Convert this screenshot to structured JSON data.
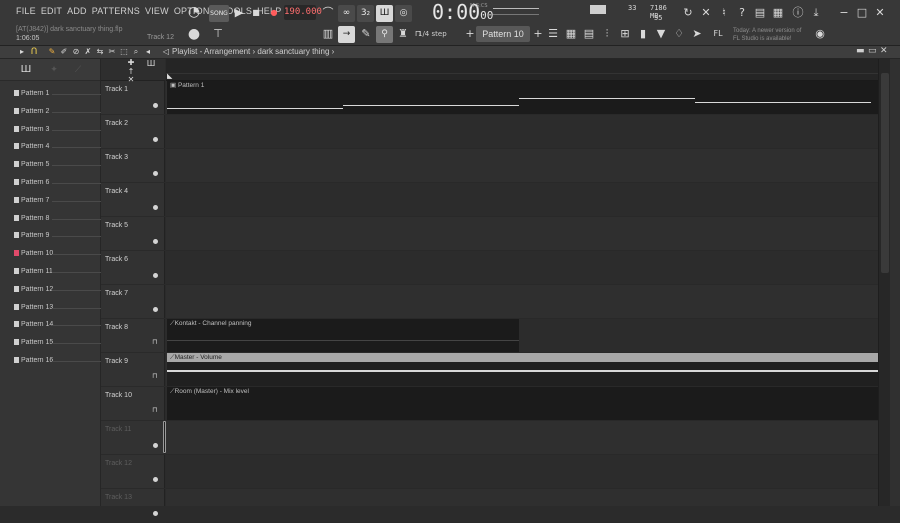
{
  "menu": [
    "FILE",
    "EDIT",
    "ADD",
    "PATTERNS",
    "VIEW",
    "OPTIONS",
    "TOOLS",
    "HELP"
  ],
  "song": {
    "filename": "[AT(J842)] dark sanctuary thing.flp",
    "position": "1:06:05",
    "hint_track": "Track 12"
  },
  "transport": {
    "tempo": "190.000",
    "time_main": "0:00",
    "time_small": "00",
    "time_label": "M:S:CS",
    "mode": "SONG"
  },
  "cpu": {
    "polyphony": "33",
    "memory": "7186 MB",
    "cpu_val": "55"
  },
  "hint": {
    "line1": "Today: A newer version of",
    "line2": "FL Studio is available!"
  },
  "toolbar": {
    "step": "1/4 step",
    "pattern": "Pattern 10"
  },
  "playlist": {
    "title": "Playlist - Arrangement",
    "breadcrumb": "dark sanctuary thing"
  },
  "patterns": [
    {
      "label": "Pattern 1"
    },
    {
      "label": "Pattern 2"
    },
    {
      "label": "Pattern 3"
    },
    {
      "label": "Pattern 4"
    },
    {
      "label": "Pattern 5"
    },
    {
      "label": "Pattern 6"
    },
    {
      "label": "Pattern 7"
    },
    {
      "label": "Pattern 8"
    },
    {
      "label": "Pattern 9"
    },
    {
      "label": "Pattern 10"
    },
    {
      "label": "Pattern 11"
    },
    {
      "label": "Pattern 12"
    },
    {
      "label": "Pattern 13"
    },
    {
      "label": "Pattern 14"
    },
    {
      "label": "Pattern 15"
    },
    {
      "label": "Pattern 16"
    }
  ],
  "tracks": [
    "Track 1",
    "Track 2",
    "Track 3",
    "Track 4",
    "Track 5",
    "Track 6",
    "Track 7",
    "Track 8",
    "Track 9",
    "Track 10",
    "Track 11",
    "Track 12",
    "Track 13"
  ],
  "clips": {
    "pattern1": "Pattern 1",
    "kontakt": "Kontakt - Channel panning",
    "master": "Master - Volume",
    "room": "Room (Master) - Mix level"
  }
}
